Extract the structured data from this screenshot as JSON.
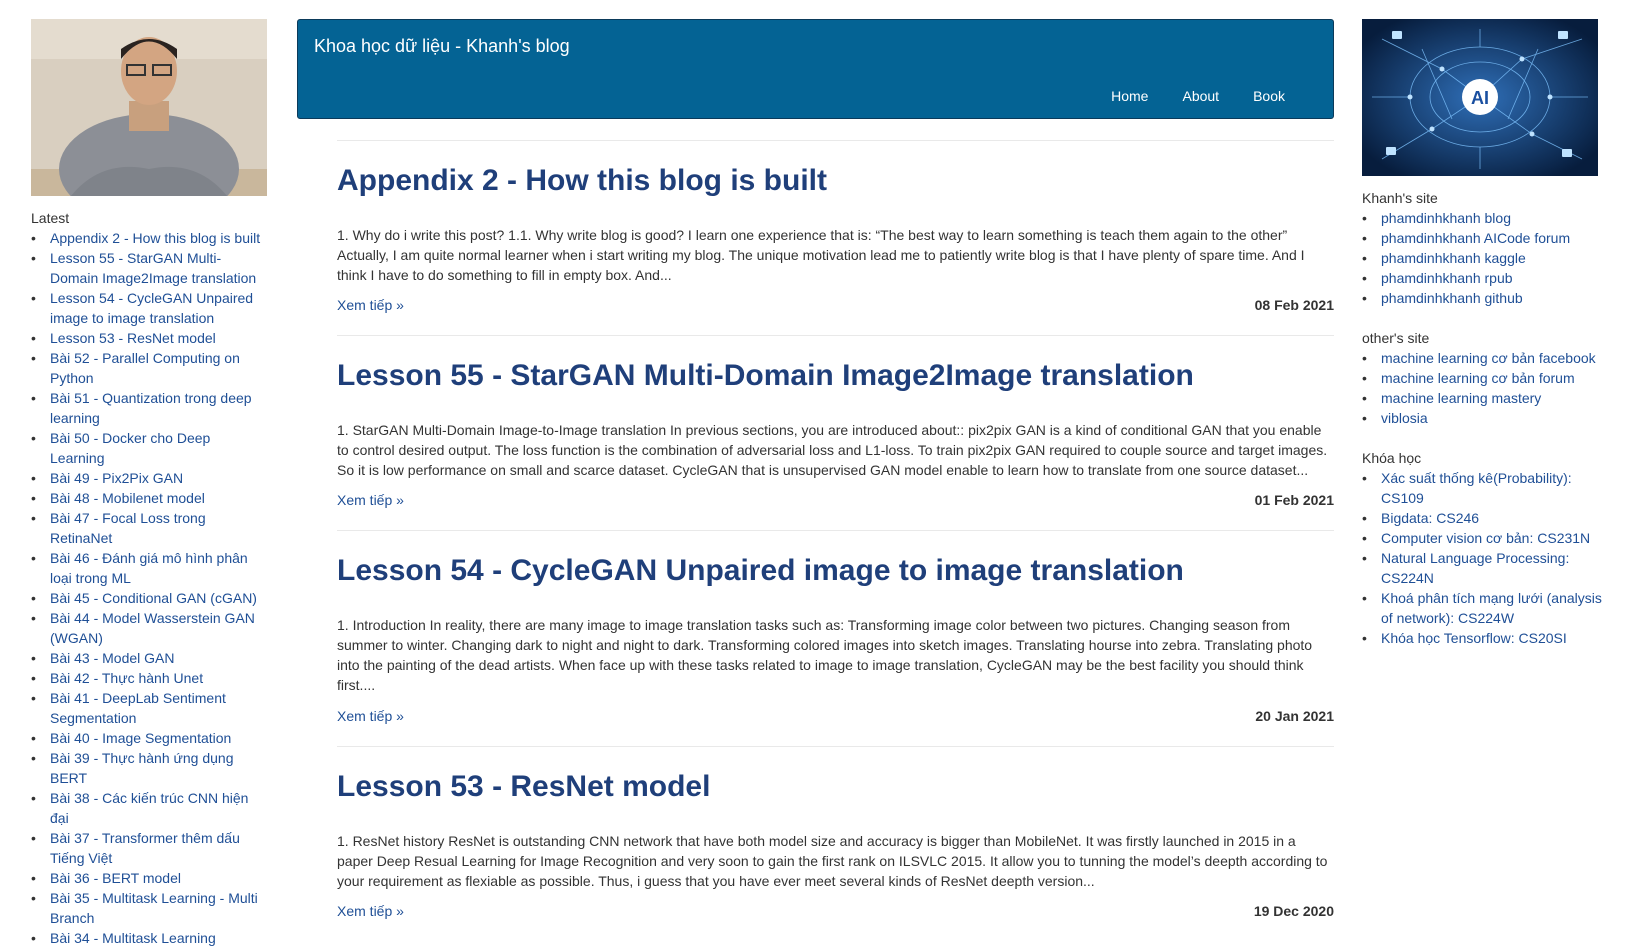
{
  "left": {
    "latest_title": "Latest",
    "latest": [
      "Appendix 2 - How this blog is built",
      "Lesson 55 - StarGAN Multi-Domain Image2Image translation",
      "Lesson 54 - CycleGAN Unpaired image to image translation",
      "Lesson 53 - ResNet model",
      "Bài 52 - Parallel Computing on Python",
      "Bài 51 - Quantization trong deep learning",
      "Bài 50 - Docker cho Deep Learning",
      "Bài 49 - Pix2Pix GAN",
      "Bài 48 - Mobilenet model",
      "Bài 47 - Focal Loss trong RetinaNet",
      "Bài 46 - Đánh giá mô hình phân loại trong ML",
      "Bài 45 - Conditional GAN (cGAN)",
      "Bài 44 - Model Wasserstein GAN (WGAN)",
      "Bài 43 - Model GAN",
      "Bài 42 - Thực hành Unet",
      "Bài 41 - DeepLab Sentiment Segmentation",
      "Bài 40 - Image Segmentation",
      "Bài 39 - Thực hành ứng dụng BERT",
      "Bài 38 - Các kiến trúc CNN hiện đại",
      "Bài 37 - Transformer thêm dấu Tiếng Việt",
      "Bài 36 - BERT model",
      "Bài 35 - Multitask Learning - Multi Branch",
      "Bài 34 - Multitask Learning"
    ]
  },
  "header": {
    "title": "Khoa học dữ liệu - Khanh's blog",
    "nav": [
      "Home",
      "About",
      "Book"
    ]
  },
  "posts": [
    {
      "title": "Appendix 2 - How this blog is built",
      "excerpt": "1. Why do i write this post? 1.1. Why write blog is good? I learn one experience that is: “The best way to learn something is teach them again to the other” Actually, I am quite normal learner when i start writing my blog. The unique motivation lead me to patiently write blog is that I have plenty of spare time. And I think I have to do something to fill in empty box. And...",
      "more": "Xem tiếp »",
      "date": "08 Feb 2021"
    },
    {
      "title": "Lesson 55 - StarGAN Multi-Domain Image2Image translation",
      "excerpt": "1. StarGAN Multi-Domain Image-to-Image translation In previous sections, you are introduced about:: pix2pix GAN is a kind of conditional GAN that you enable to control desired output. The loss function is the combination of adversarial loss and L1-loss. To train pix2pix GAN required to couple source and target images. So it is low performance on small and scarce dataset. CycleGAN that is unsupervised GAN model enable to learn how to translate from one source dataset...",
      "more": "Xem tiếp »",
      "date": "01 Feb 2021"
    },
    {
      "title": "Lesson 54 - CycleGAN Unpaired image to image translation",
      "excerpt": "1. Introduction In reality, there are many image to image translation tasks such as: Transforming image color between two pictures. Changing season from summer to winter. Changing dark to night and night to dark. Transforming colored images into sketch images. Translating hourse into zebra. Translating photo into the painting of the dead artists. When face up with these tasks related to image to image translation, CycleGAN may be the best facility you should think first....",
      "more": "Xem tiếp »",
      "date": "20 Jan 2021"
    },
    {
      "title": "Lesson 53 - ResNet model",
      "excerpt": "1. ResNet history ResNet is outstanding CNN network that have both model size and accuracy is bigger than MobileNet. It was firstly launched in 2015 in a paper Deep Resual Learning for Image Recognition and very soon to gain the first rank on ILSVLC 2015. It allow you to tunning the model’s deepth according to your requirement as flexiable as possible. Thus, i guess that you have ever meet several kinds of ResNet deepth version...",
      "more": "Xem tiếp »",
      "date": "19 Dec 2020"
    }
  ],
  "right": {
    "groups": [
      {
        "title": "Khanh's site",
        "links": [
          "phamdinhkhanh blog",
          "phamdinhkhanh AICode forum",
          "phamdinhkhanh kaggle",
          "phamdinhkhanh rpub",
          "phamdinhkhanh github"
        ]
      },
      {
        "title": "other's site",
        "links": [
          "machine learning cơ bản facebook",
          "machine learning cơ bản forum",
          "machine learning mastery",
          "viblosia"
        ]
      },
      {
        "title": "Khóa học",
        "links": [
          "Xác suất thống kê(Probability): CS109",
          "Bigdata: CS246",
          "Computer vision cơ bản: CS231N",
          "Natural Language Processing: CS224N",
          "Khoá phân tích mạng lưới (analysis of network): CS224W",
          "Khóa học Tensorflow: CS20SI"
        ]
      }
    ],
    "ai_badge": "AI"
  },
  "colors": {
    "header_bg": "#046394",
    "link": "#1f4f96",
    "title": "#1f3f7a"
  }
}
